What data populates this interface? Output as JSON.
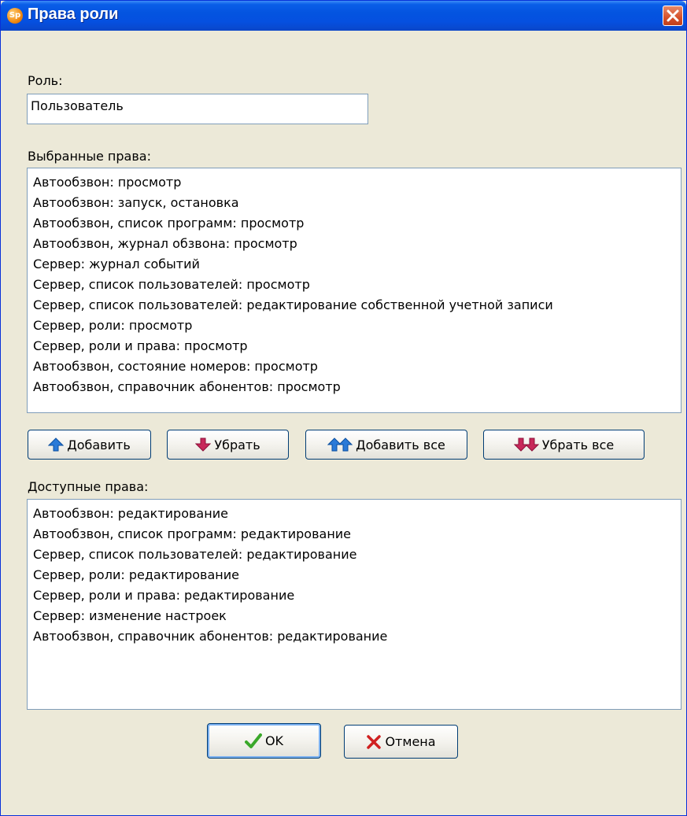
{
  "window": {
    "title": "Права роли",
    "app_icon_text": "Sp"
  },
  "role": {
    "label": "Роль:",
    "value": "Пользователь"
  },
  "selected": {
    "label": "Выбранные права:",
    "items": [
      "Автообзвон: просмотр",
      "Автообзвон: запуск, остановка",
      "Автообзвон, список программ: просмотр",
      "Автообзвон, журнал обзвона: просмотр",
      "Сервер: журнал событий",
      "Сервер, список пользователей: просмотр",
      "Сервер, список пользователей: редактирование собственной учетной записи",
      "Сервер, роли: просмотр",
      "Сервер, роли и права: просмотр",
      "Автообзвон, состояние номеров: просмотр",
      "Автообзвон, справочник абонентов: просмотр"
    ]
  },
  "actions": {
    "add": "Добавить",
    "remove": "Убрать",
    "add_all": "Добавить все",
    "remove_all": "Убрать все"
  },
  "available": {
    "label": "Доступные права:",
    "items": [
      "Автообзвон: редактирование",
      "Автообзвон, список программ: редактирование",
      "Сервер, список пользователей: редактирование",
      "Сервер, роли: редактирование",
      "Сервер, роли и права: редактирование",
      "Сервер: изменение настроек",
      "Автообзвон, справочник абонентов: редактирование"
    ]
  },
  "footer": {
    "ok": "OK",
    "cancel": "Отмена"
  },
  "colors": {
    "title_bar": "#0454e0",
    "dialog_bg": "#ece9d8",
    "arrow_blue": "#2a7ad8",
    "arrow_red": "#c8285a",
    "ok_check": "#3aa82a",
    "cancel_x": "#d02020"
  }
}
